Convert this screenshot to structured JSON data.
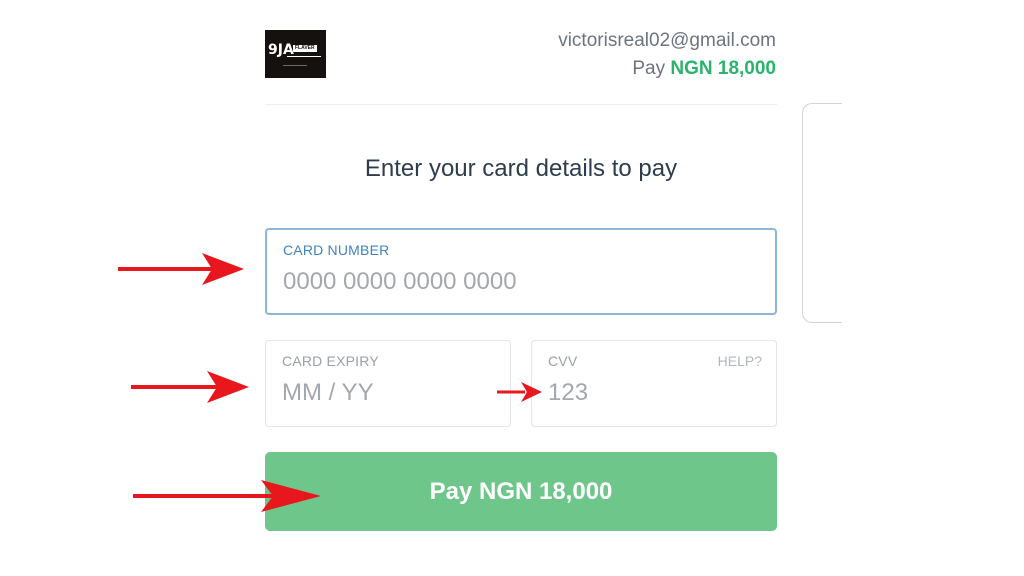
{
  "merchant": {
    "email": "victorisreal02@gmail.com",
    "pay_prefix": "Pay",
    "amount": "NGN 18,000"
  },
  "form": {
    "heading": "Enter your card details to pay",
    "card_number": {
      "label": "CARD NUMBER",
      "placeholder": "0000 0000 0000 0000",
      "value": ""
    },
    "card_expiry": {
      "label": "CARD EXPIRY",
      "placeholder": "MM / YY",
      "value": ""
    },
    "cvv": {
      "label": "CVV",
      "placeholder": "123",
      "value": "",
      "help_label": "HELP?"
    },
    "pay_button_label": "Pay NGN 18,000"
  },
  "annotations": {
    "arrow_color": "#e8171d"
  },
  "colors": {
    "accent_green": "#29b36b",
    "button_green": "#6fc68a",
    "focus_blue": "#3f83bd"
  }
}
